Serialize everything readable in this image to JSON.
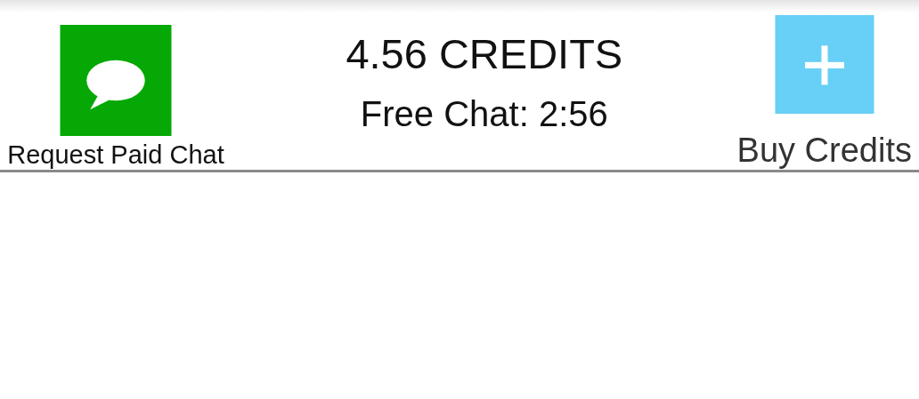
{
  "paid_chat_button": {
    "label": "Request Paid Chat"
  },
  "credits": "4.56 CREDITS",
  "free_chat": "Free Chat: 2:56",
  "buy_credits_button": {
    "label": "Buy Credits"
  }
}
